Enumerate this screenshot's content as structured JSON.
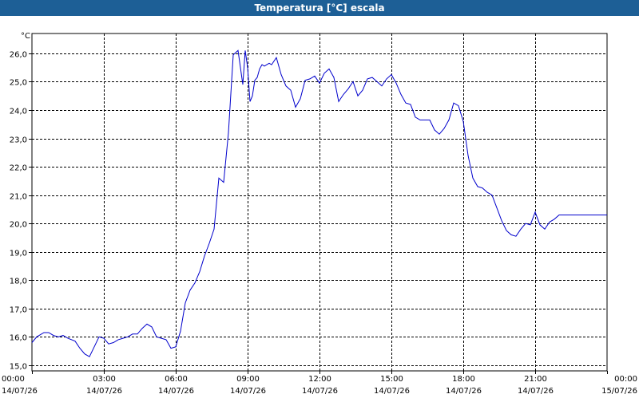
{
  "window": {
    "title": "Temperatura [°C] escala"
  },
  "chart_data": {
    "type": "line",
    "title": "Temperatura [°C] escala",
    "ylabel": "°C",
    "xlabel": "",
    "ylim": [
      14.8,
      26.7
    ],
    "y_ticks": [
      "15,0",
      "16,0",
      "17,0",
      "18,0",
      "19,0",
      "20,0",
      "21,0",
      "22,0",
      "23,0",
      "24,0",
      "25,0",
      "26,0"
    ],
    "y_tick_values": [
      15,
      16,
      17,
      18,
      19,
      20,
      21,
      22,
      23,
      24,
      25,
      26
    ],
    "xlim": [
      0,
      24
    ],
    "x_ticks": [
      {
        "time": "00:00",
        "date": "14/07/26",
        "hour": 0
      },
      {
        "time": "03:00",
        "date": "14/07/26",
        "hour": 3
      },
      {
        "time": "06:00",
        "date": "14/07/26",
        "hour": 6
      },
      {
        "time": "09:00",
        "date": "14/07/26",
        "hour": 9
      },
      {
        "time": "12:00",
        "date": "14/07/26",
        "hour": 12
      },
      {
        "time": "15:00",
        "date": "14/07/26",
        "hour": 15
      },
      {
        "time": "18:00",
        "date": "14/07/26",
        "hour": 18
      },
      {
        "time": "21:00",
        "date": "14/07/26",
        "hour": 21
      },
      {
        "time": "00:00",
        "date": "15/07/26",
        "hour": 24
      }
    ],
    "grid": true,
    "legend": "none",
    "line_color": "#0000cc",
    "series": [
      {
        "x": [
          0,
          0.2,
          0.5,
          0.7,
          0.9,
          1.1,
          1.3,
          1.5,
          1.8,
          2.0,
          2.2,
          2.4,
          2.6,
          2.8,
          3.0,
          3.2,
          3.4,
          3.6,
          3.8,
          4.0,
          4.2,
          4.4,
          4.6,
          4.8,
          5.0,
          5.2,
          5.4,
          5.6,
          5.8,
          6.0,
          6.2,
          6.4,
          6.6,
          6.8,
          7.0,
          7.2,
          7.4,
          7.6,
          7.8,
          8.0,
          8.2,
          8.4,
          8.6,
          8.8,
          8.9,
          9.0,
          9.1,
          9.2,
          9.3,
          9.4,
          9.5,
          9.6,
          9.7,
          9.8,
          9.9,
          10.0,
          10.2,
          10.4,
          10.6,
          10.8,
          11.0,
          11.2,
          11.4,
          11.6,
          11.8,
          12.0,
          12.2,
          12.4,
          12.6,
          12.8,
          13.0,
          13.2,
          13.4,
          13.6,
          13.8,
          14.0,
          14.2,
          14.4,
          14.6,
          14.8,
          15.0,
          15.2,
          15.4,
          15.6,
          15.8,
          16.0,
          16.2,
          16.4,
          16.6,
          16.8,
          17.0,
          17.2,
          17.4,
          17.6,
          17.8,
          18.0,
          18.2,
          18.4,
          18.6,
          18.8,
          19.0,
          19.2,
          19.4,
          19.6,
          19.8,
          20.0,
          20.2,
          20.4,
          20.6,
          20.8,
          21.0,
          21.2,
          21.4,
          21.6,
          21.8,
          22.0,
          22.2,
          22.4,
          22.6,
          22.8,
          23.0,
          23.2,
          23.4,
          23.6,
          23.8,
          24.0
        ],
        "y": [
          15.8,
          16.0,
          16.15,
          16.15,
          16.05,
          16.0,
          16.05,
          15.95,
          15.85,
          15.6,
          15.4,
          15.3,
          15.65,
          16.0,
          15.95,
          15.75,
          15.8,
          15.9,
          15.95,
          16.0,
          16.1,
          16.1,
          16.3,
          16.45,
          16.35,
          16.0,
          15.95,
          15.9,
          15.6,
          15.65,
          16.2,
          17.2,
          17.65,
          17.9,
          18.3,
          18.85,
          19.3,
          19.8,
          21.6,
          21.45,
          23.2,
          25.95,
          26.1,
          24.9,
          26.1,
          25.5,
          24.3,
          24.5,
          25.05,
          25.15,
          25.45,
          25.6,
          25.55,
          25.6,
          25.65,
          25.6,
          25.85,
          25.25,
          24.85,
          24.7,
          24.1,
          24.4,
          25.05,
          25.1,
          25.2,
          24.95,
          25.3,
          25.45,
          25.15,
          24.3,
          24.55,
          24.75,
          25.0,
          24.5,
          24.7,
          25.1,
          25.15,
          25.0,
          24.85,
          25.1,
          25.25,
          24.95,
          24.55,
          24.25,
          24.2,
          23.75,
          23.65,
          23.65,
          23.65,
          23.3,
          23.15,
          23.35,
          23.65,
          24.25,
          24.15,
          23.6,
          22.4,
          21.6,
          21.3,
          21.25,
          21.1,
          21.0,
          20.55,
          20.1,
          19.75,
          19.6,
          19.55,
          19.8,
          20.0,
          19.95,
          20.4,
          19.95,
          19.8,
          20.05,
          20.15,
          20.3,
          20.3,
          20.3,
          20.3,
          20.3,
          20.3,
          20.3,
          20.3,
          20.3,
          20.3,
          20.3
        ]
      }
    ]
  }
}
